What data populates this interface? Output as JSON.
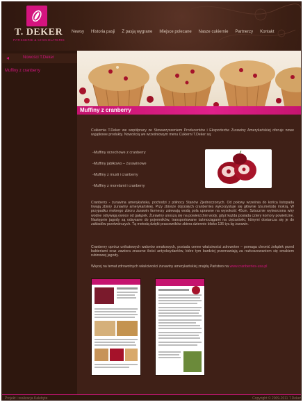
{
  "brand": {
    "name": "T. DEKER",
    "tagline": "PATISSERIE & CHOCOLATERIE"
  },
  "nav": {
    "items": [
      "Newsy",
      "Historia pasji",
      "Z pasją wygrane",
      "Miejsce polecane",
      "Nasze cukiernie",
      "Partnerzy",
      "Kontakt"
    ]
  },
  "sidebar": {
    "back_label": "Nowości T.Deker",
    "current_item": "Muffiny z cranberry"
  },
  "page": {
    "title": "Muffiny z cranberry",
    "intro": "Cukiernia T.Deker we współpracy ze Stowarzyszeniem Producentów i Eksporterów Żurawiny Amerykańskiej oferuje nowe wyjątkowe produkty. Nowością we wrześniowym menu Cukierni T.Deker są:",
    "products": [
      "-Muffiny orzechowe z cranberry",
      "-Muffiny jabłkowo – żurawinowe",
      "-Muffiny z musli i cranberry",
      "-Muffiny z morelami i cranberry"
    ],
    "para_cranberry": "Cranberry - żurawina amerykańska, pochodzi z północy Stanów Zjednoczonych. Od połowy września do końca listopada trwają zbiory żurawiny amerykańskiej. Przy zbiorze dojrzałych cranberries wykorzystuje się głównie tzw.metodę mokrą. W przypadku mokrego zbioru żurawin farmerzy zalewają wodą pola uprawne na wysokość 45cm. Sztucznie wytworzona wiry wodne odrywają owoce od gałązek. Żurawiny unoszą się na powierzchni wody, gdyż każda posiada cztery komory powietrzne. Następnie jagody są odsysane do pojemników, transportowane taśmociągami na ciężarówki, którymi dostarcza się je do zakładów przetwórczych. Tą metodą dzięki pracowników zbiera dziennie blisko 136 tys.kg żurawin.",
    "para_health": "Cranberry oprócz unikatowych walorów smakowych, posiada cenne właściwości zdrowotne – pomaga chronić żołądek przed bakteriami oraz zawiera znaczne ilości antyoksydantów, które tym bardziej przemawiają za rozkoszowaniem się smakiem rubinowej jagody.",
    "more_info_text": "Więcej na temat zdrowotnych właściwości żurawiny amerykańskiej znajdą Państwo na",
    "more_info_link": "www.cranberries-usa.pl"
  },
  "footer": {
    "left": "Projekt i realizacja Kalebyte",
    "right": "Copyright © 2009-2011 T.Deker"
  },
  "colors": {
    "accent": "#d4147f",
    "background": "#3a1e14",
    "text": "#cbb9ad"
  }
}
